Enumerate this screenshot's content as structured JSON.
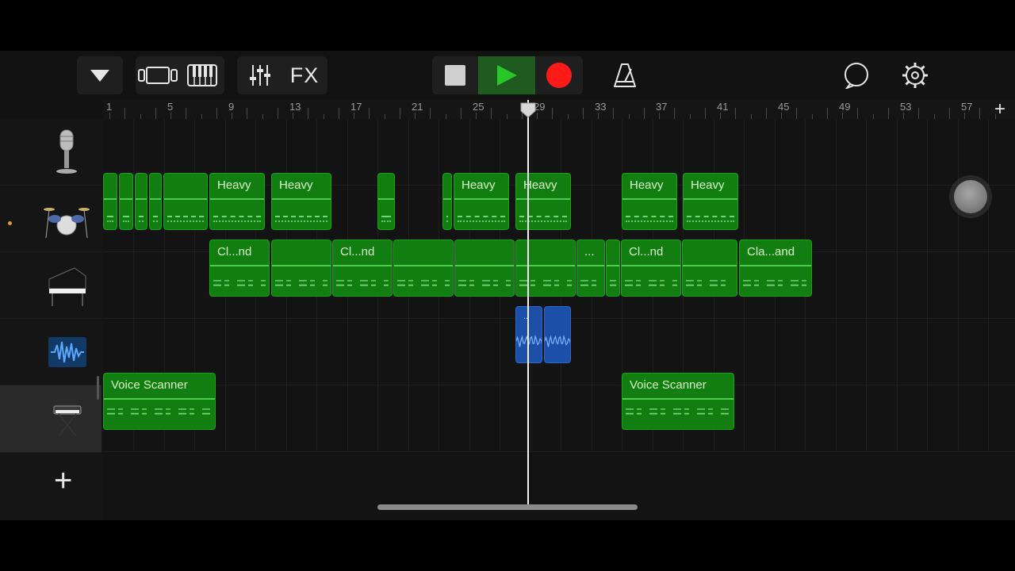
{
  "toolbar": {
    "fx_label": "FX",
    "icons": [
      "browser-dropdown-icon",
      "tracks-view-icon",
      "keyboard-icon",
      "mixer-icon",
      "fx-icon",
      "stop-icon",
      "play-icon",
      "record-icon",
      "metronome-icon",
      "loop-icon",
      "settings-icon"
    ],
    "colors": {
      "play_active_bg": "#1f5a1f",
      "play_icon": "#27c727",
      "record": "#ff1a1a"
    }
  },
  "ruler": {
    "bars": [
      "1",
      "5",
      "9",
      "13",
      "17",
      "21",
      "25",
      "29",
      "33",
      "37",
      "41",
      "45",
      "49",
      "53",
      "57"
    ],
    "add_label": "+"
  },
  "tracks": [
    {
      "icon": "microphone-icon",
      "type": "audio-recorder"
    },
    {
      "icon": "drum-kit-icon",
      "type": "drums"
    },
    {
      "icon": "grand-piano-icon",
      "type": "keyboard"
    },
    {
      "icon": "waveform-icon",
      "type": "audio"
    },
    {
      "icon": "synth-keyboard-icon",
      "type": "synth",
      "selected": true
    }
  ],
  "regions": {
    "drums": [
      {
        "name": ""
      },
      {
        "name": ""
      },
      {
        "name": ""
      },
      {
        "name": ""
      },
      {
        "name": ""
      },
      {
        "name": "Heavy"
      },
      {
        "name": "Heavy"
      },
      {
        "name": ""
      },
      {
        "name": ""
      },
      {
        "name": "Heavy"
      },
      {
        "name": "Heavy"
      },
      {
        "name": "Heavy"
      },
      {
        "name": "Heavy"
      }
    ],
    "piano": [
      {
        "name": "Cl...nd"
      },
      {
        "name": ""
      },
      {
        "name": "Cl...nd"
      },
      {
        "name": ""
      },
      {
        "name": ""
      },
      {
        "name": ""
      },
      {
        "name": "..."
      },
      {
        "name": ""
      },
      {
        "name": "Cl...nd"
      },
      {
        "name": ""
      },
      {
        "name": "Cla...and"
      }
    ],
    "audio": [
      {
        "name": ".."
      },
      {
        "name": ""
      }
    ],
    "synth": [
      {
        "name": "Voice Scanner"
      },
      {
        "name": "Voice Scanner"
      }
    ]
  },
  "add_track_label": "+",
  "playhead_bar": 28.7
}
